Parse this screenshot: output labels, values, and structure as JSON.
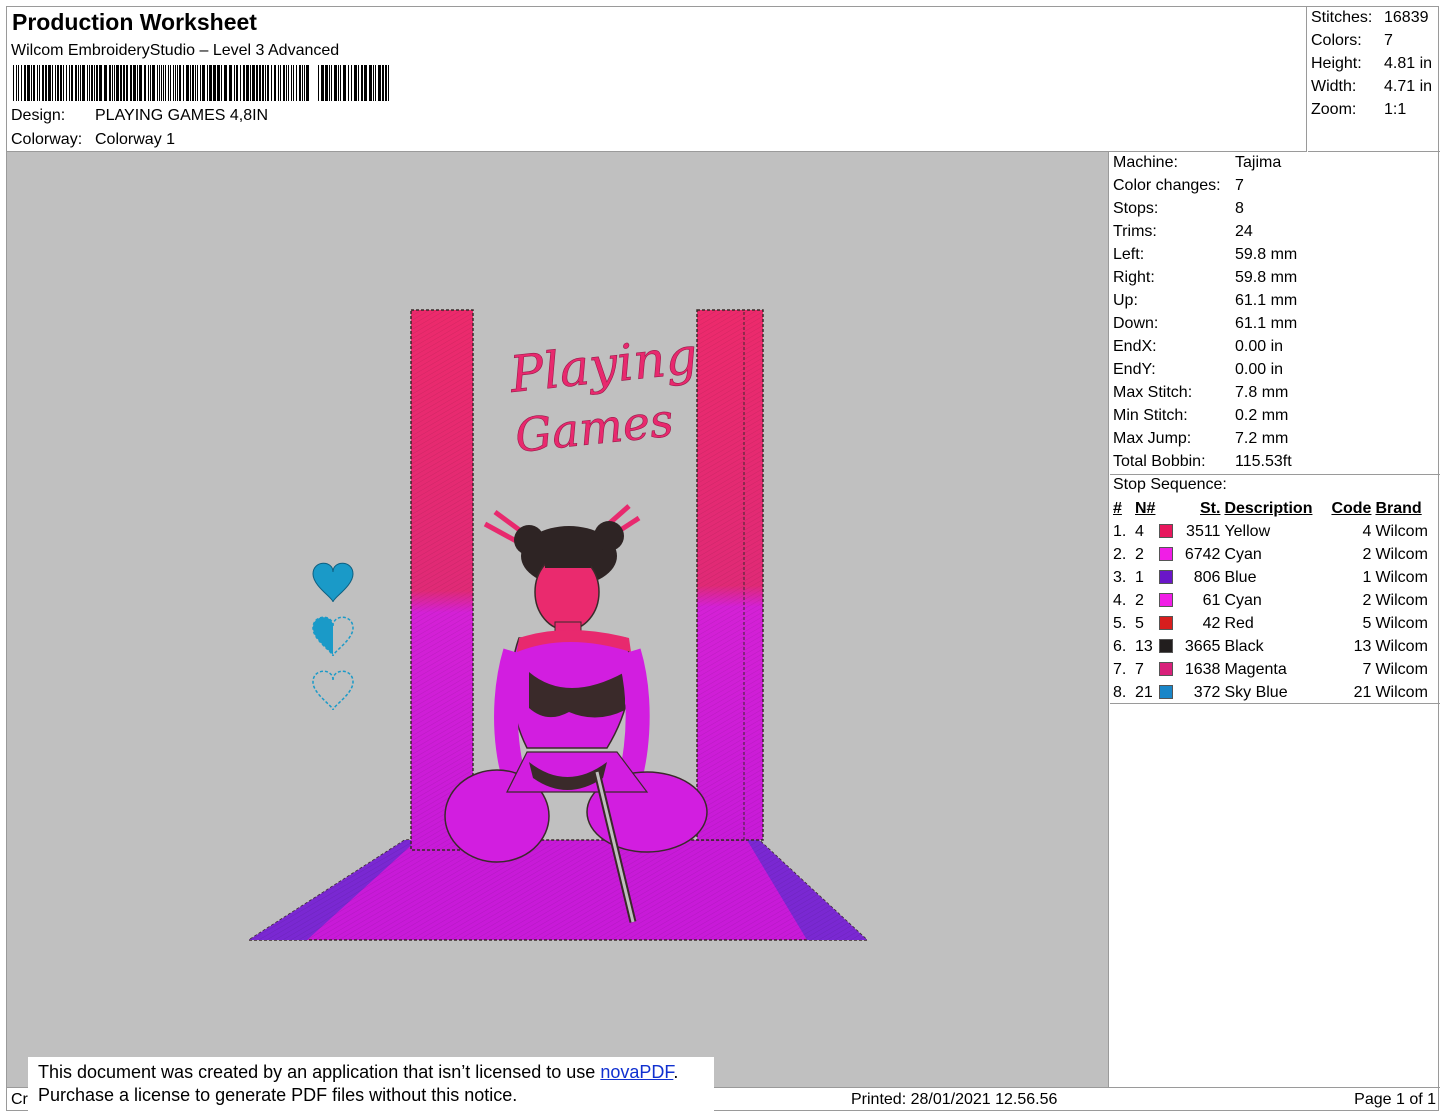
{
  "header": {
    "title": "Production Worksheet",
    "software": "Wilcom EmbroideryStudio – Level 3 Advanced",
    "design_label": "Design:",
    "design_value": "PLAYING GAMES 4,8IN",
    "colorway_label": "Colorway:",
    "colorway_value": "Colorway 1"
  },
  "summary": [
    {
      "label": "Stitches:",
      "value": "16839"
    },
    {
      "label": "Colors:",
      "value": "7"
    },
    {
      "label": "Height:",
      "value": "4.81 in"
    },
    {
      "label": "Width:",
      "value": "4.71 in"
    },
    {
      "label": "Zoom:",
      "value": "1:1"
    }
  ],
  "machine_info": [
    {
      "label": "Machine:",
      "value": "Tajima"
    },
    {
      "label": "Color changes:",
      "value": "7"
    },
    {
      "label": "Stops:",
      "value": "8"
    },
    {
      "label": "Trims:",
      "value": "24"
    },
    {
      "label": "Left:",
      "value": "59.8 mm"
    },
    {
      "label": "Right:",
      "value": "59.8 mm"
    },
    {
      "label": "Up:",
      "value": "61.1 mm"
    },
    {
      "label": "Down:",
      "value": "61.1 mm"
    },
    {
      "label": "EndX:",
      "value": "0.00 in"
    },
    {
      "label": "EndY:",
      "value": "0.00 in"
    },
    {
      "label": "Max Stitch:",
      "value": "7.8 mm"
    },
    {
      "label": "Min Stitch:",
      "value": "0.2 mm"
    },
    {
      "label": "Max Jump:",
      "value": "7.2 mm"
    },
    {
      "label": "Total Bobbin:",
      "value": "115.53ft"
    }
  ],
  "stop_sequence": {
    "title": "Stop Sequence:",
    "headers": {
      "idx": "#",
      "n": "N#",
      "st": "St.",
      "desc": "Description",
      "code": "Code",
      "brand": "Brand"
    },
    "rows": [
      {
        "idx": "1.",
        "n": "4",
        "color": "#e8175d",
        "st": "3511",
        "desc": "Yellow",
        "code": "4",
        "brand": "Wilcom"
      },
      {
        "idx": "2.",
        "n": "2",
        "color": "#f01ee6",
        "st": "6742",
        "desc": "Cyan",
        "code": "2",
        "brand": "Wilcom"
      },
      {
        "idx": "3.",
        "n": "1",
        "color": "#6a16c8",
        "st": "806",
        "desc": "Blue",
        "code": "1",
        "brand": "Wilcom"
      },
      {
        "idx": "4.",
        "n": "2",
        "color": "#f01ee6",
        "st": "61",
        "desc": "Cyan",
        "code": "2",
        "brand": "Wilcom"
      },
      {
        "idx": "5.",
        "n": "5",
        "color": "#d81e1e",
        "st": "42",
        "desc": "Red",
        "code": "5",
        "brand": "Wilcom"
      },
      {
        "idx": "6.",
        "n": "13",
        "color": "#221e1e",
        "st": "3665",
        "desc": "Black",
        "code": "13",
        "brand": "Wilcom"
      },
      {
        "idx": "7.",
        "n": "7",
        "color": "#d8207a",
        "st": "1638",
        "desc": "Magenta",
        "code": "7",
        "brand": "Wilcom"
      },
      {
        "idx": "8.",
        "n": "21",
        "color": "#1a86c8",
        "st": "372",
        "desc": "Sky Blue",
        "code": "21",
        "brand": "Wilcom"
      }
    ]
  },
  "design_art": {
    "lettering": "Playing Games",
    "background_color": "#c0c0c0",
    "pink_color": "#e8296e",
    "magenta_color": "#d21ee0",
    "purple_color": "#7a28d2",
    "outline_color": "#3a2a2a",
    "heart_color": "#1a9ac8"
  },
  "footer": {
    "left": "Cr",
    "printed": "Printed: 28/01/2021 12.56.56",
    "page": "Page 1 of 1"
  },
  "notice": {
    "line1_before": "This document was created by an application that isn’t licensed to use ",
    "link": "novaPDF",
    "line1_after": ".",
    "line2": "Purchase a license to generate PDF files without this notice."
  }
}
